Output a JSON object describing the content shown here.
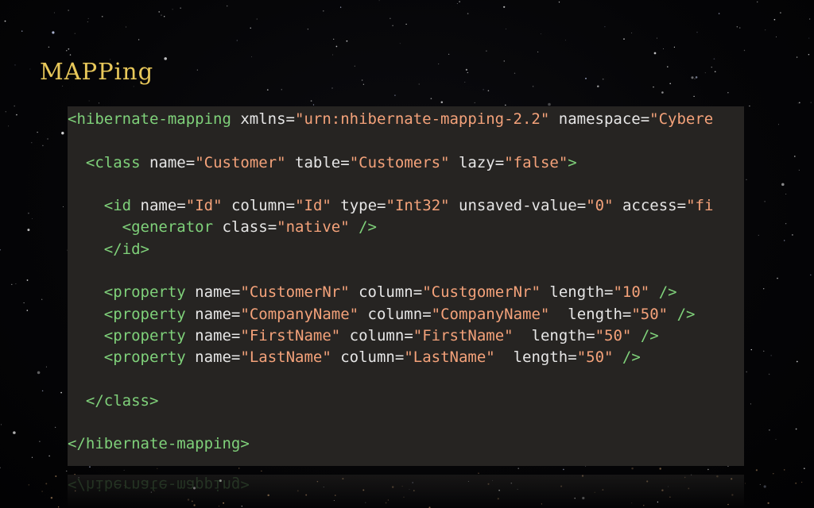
{
  "slide": {
    "title": "MAPPing"
  },
  "code": {
    "lines": [
      [
        [
          "tag",
          "<hibernate-mapping "
        ],
        [
          "attr",
          "xmlns"
        ],
        [
          "plain",
          "="
        ],
        [
          "val",
          "\"urn:nhibernate-mapping-2.2\""
        ],
        [
          "plain",
          " "
        ],
        [
          "attr",
          "namespace"
        ],
        [
          "plain",
          "="
        ],
        [
          "val",
          "\"Cybere"
        ]
      ],
      [],
      [
        [
          "plain",
          "  "
        ],
        [
          "tag",
          "<class "
        ],
        [
          "attr",
          "name"
        ],
        [
          "plain",
          "="
        ],
        [
          "val",
          "\"Customer\""
        ],
        [
          "plain",
          " "
        ],
        [
          "attr",
          "table"
        ],
        [
          "plain",
          "="
        ],
        [
          "val",
          "\"Customers\""
        ],
        [
          "plain",
          " "
        ],
        [
          "attr",
          "lazy"
        ],
        [
          "plain",
          "="
        ],
        [
          "val",
          "\"false\""
        ],
        [
          "tag",
          ">"
        ]
      ],
      [],
      [
        [
          "plain",
          "    "
        ],
        [
          "tag",
          "<id "
        ],
        [
          "attr",
          "name"
        ],
        [
          "plain",
          "="
        ],
        [
          "val",
          "\"Id\""
        ],
        [
          "plain",
          " "
        ],
        [
          "attr",
          "column"
        ],
        [
          "plain",
          "="
        ],
        [
          "val",
          "\"Id\""
        ],
        [
          "plain",
          " "
        ],
        [
          "attr",
          "type"
        ],
        [
          "plain",
          "="
        ],
        [
          "val",
          "\"Int32\""
        ],
        [
          "plain",
          " "
        ],
        [
          "attr",
          "unsaved-value"
        ],
        [
          "plain",
          "="
        ],
        [
          "val",
          "\"0\""
        ],
        [
          "plain",
          " "
        ],
        [
          "attr",
          "access"
        ],
        [
          "plain",
          "="
        ],
        [
          "val",
          "\"fi"
        ]
      ],
      [
        [
          "plain",
          "      "
        ],
        [
          "tag",
          "<generator "
        ],
        [
          "attr",
          "class"
        ],
        [
          "plain",
          "="
        ],
        [
          "val",
          "\"native\""
        ],
        [
          "plain",
          " "
        ],
        [
          "tag",
          "/>"
        ]
      ],
      [
        [
          "plain",
          "    "
        ],
        [
          "tag",
          "</id>"
        ]
      ],
      [],
      [
        [
          "plain",
          "    "
        ],
        [
          "tag",
          "<property "
        ],
        [
          "attr",
          "name"
        ],
        [
          "plain",
          "="
        ],
        [
          "val",
          "\"CustomerNr\""
        ],
        [
          "plain",
          " "
        ],
        [
          "attr",
          "column"
        ],
        [
          "plain",
          "="
        ],
        [
          "val",
          "\"CustgomerNr\""
        ],
        [
          "plain",
          " "
        ],
        [
          "attr",
          "length"
        ],
        [
          "plain",
          "="
        ],
        [
          "val",
          "\"10\""
        ],
        [
          "plain",
          " "
        ],
        [
          "tag",
          "/>"
        ]
      ],
      [
        [
          "plain",
          "    "
        ],
        [
          "tag",
          "<property "
        ],
        [
          "attr",
          "name"
        ],
        [
          "plain",
          "="
        ],
        [
          "val",
          "\"CompanyName\""
        ],
        [
          "plain",
          " "
        ],
        [
          "attr",
          "column"
        ],
        [
          "plain",
          "="
        ],
        [
          "val",
          "\"CompanyName\""
        ],
        [
          "plain",
          "  "
        ],
        [
          "attr",
          "length"
        ],
        [
          "plain",
          "="
        ],
        [
          "val",
          "\"50\""
        ],
        [
          "plain",
          " "
        ],
        [
          "tag",
          "/>"
        ]
      ],
      [
        [
          "plain",
          "    "
        ],
        [
          "tag",
          "<property "
        ],
        [
          "attr",
          "name"
        ],
        [
          "plain",
          "="
        ],
        [
          "val",
          "\"FirstName\""
        ],
        [
          "plain",
          " "
        ],
        [
          "attr",
          "column"
        ],
        [
          "plain",
          "="
        ],
        [
          "val",
          "\"FirstName\""
        ],
        [
          "plain",
          "  "
        ],
        [
          "attr",
          "length"
        ],
        [
          "plain",
          "="
        ],
        [
          "val",
          "\"50\""
        ],
        [
          "plain",
          " "
        ],
        [
          "tag",
          "/>"
        ]
      ],
      [
        [
          "plain",
          "    "
        ],
        [
          "tag",
          "<property "
        ],
        [
          "attr",
          "name"
        ],
        [
          "plain",
          "="
        ],
        [
          "val",
          "\"LastName\""
        ],
        [
          "plain",
          " "
        ],
        [
          "attr",
          "column"
        ],
        [
          "plain",
          "="
        ],
        [
          "val",
          "\"LastName\""
        ],
        [
          "plain",
          "  "
        ],
        [
          "attr",
          "length"
        ],
        [
          "plain",
          "="
        ],
        [
          "val",
          "\"50\""
        ],
        [
          "plain",
          " "
        ],
        [
          "tag",
          "/>"
        ]
      ],
      [],
      [
        [
          "plain",
          "  "
        ],
        [
          "tag",
          "</class>"
        ]
      ],
      [],
      [
        [
          "tag",
          "</hibernate-mapping>"
        ]
      ]
    ],
    "reflection": "</hibernate-mapping>"
  },
  "colors": {
    "background": "#050505",
    "title": "#e8c85a",
    "code_background": "#262422",
    "tag": "#7fd17a",
    "attribute": "#e6e6e6",
    "value": "#f4a27a"
  }
}
